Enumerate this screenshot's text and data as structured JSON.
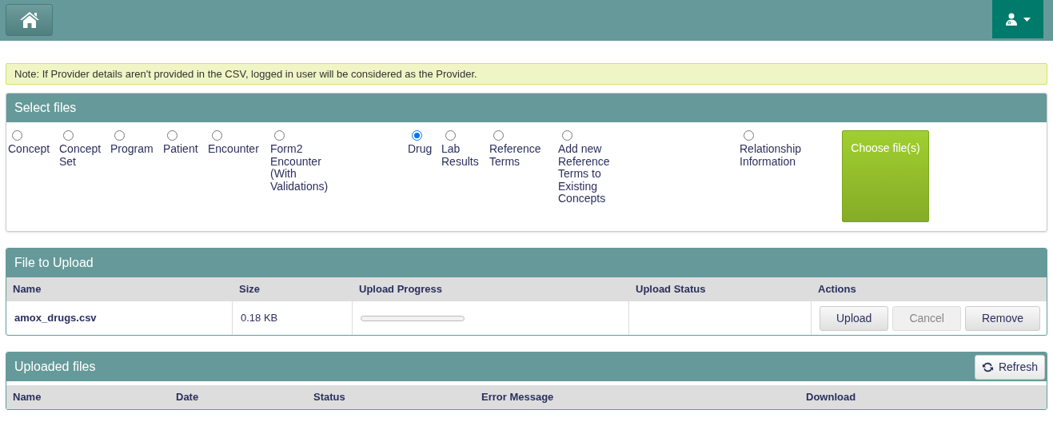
{
  "note": "Note: If Provider details aren't provided in the CSV, logged in user will be considered as the Provider.",
  "select_files": {
    "title": "Select files",
    "options": [
      {
        "label": "Concept",
        "selected": false
      },
      {
        "label": "Concept Set",
        "selected": false
      },
      {
        "label": "Program",
        "selected": false
      },
      {
        "label": "Patient",
        "selected": false
      },
      {
        "label": "Encounter",
        "selected": false
      },
      {
        "label": "Form2 Encounter (With Validations)",
        "selected": false
      },
      {
        "label": "Drug",
        "selected": true
      },
      {
        "label": "Lab Results",
        "selected": false
      },
      {
        "label": "Reference Terms",
        "selected": false
      },
      {
        "label": "Add new Reference Terms to Existing Concepts",
        "selected": false
      },
      {
        "label": "Relationship Information",
        "selected": false
      }
    ],
    "choose_button": "Choose file(s)"
  },
  "file_to_upload": {
    "title": "File to Upload",
    "columns": [
      "Name",
      "Size",
      "Upload Progress",
      "Upload Status",
      "Actions"
    ],
    "rows": [
      {
        "name": "amox_drugs.csv",
        "size": "0.18 KB",
        "level": 0,
        "actions": [
          {
            "label": "Upload",
            "disabled": false
          },
          {
            "label": "Cancel",
            "disabled": true
          },
          {
            "label": "Remove",
            "disabled": false
          }
        ]
      }
    ]
  },
  "uploaded_files": {
    "title": "Uploaded files",
    "refresh_button": "Refresh",
    "columns": [
      "Name",
      "Date",
      "Status",
      "Error Message",
      "Download"
    ]
  }
}
